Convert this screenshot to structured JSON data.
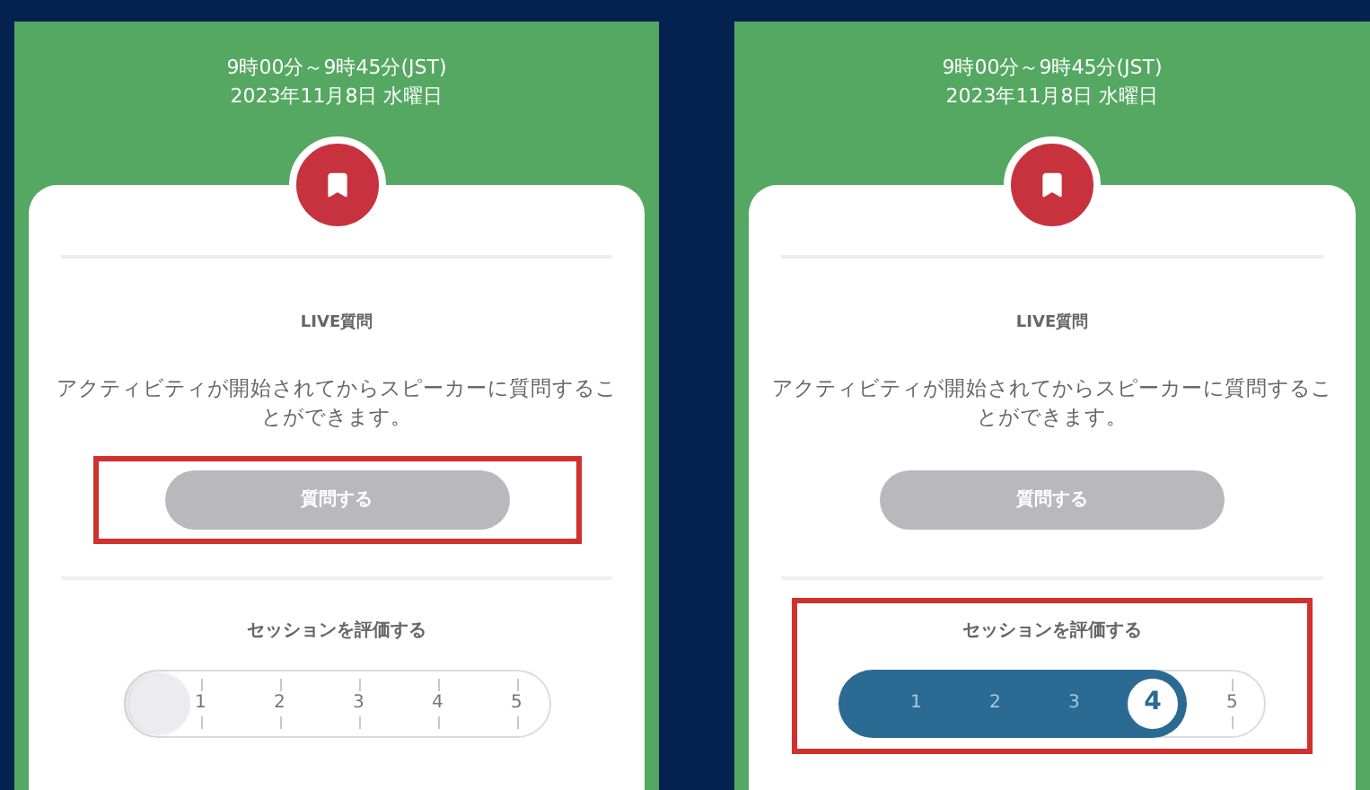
{
  "screens": [
    {
      "header": {
        "time": "9時00分～9時45分(JST)",
        "date": "2023年11月8日 水曜日"
      },
      "live_question": {
        "title": "LIVE質問",
        "description": "アクティビティが開始されてからスピーカーに質問することができます。",
        "button": {
          "label": "質問する",
          "disabled": true
        },
        "highlighted": true
      },
      "rating": {
        "title": "セッションを評価する",
        "scale": [
          "1",
          "2",
          "3",
          "4",
          "5"
        ],
        "level": 0,
        "highlighted": false
      }
    },
    {
      "header": {
        "time": "9時00分～9時45分(JST)",
        "date": "2023年11月8日 水曜日"
      },
      "live_question": {
        "title": "LIVE質問",
        "description": "アクティビティが開始されてからスピーカーに質問することができます。",
        "button": {
          "label": "質問する",
          "disabled": true
        },
        "highlighted": false
      },
      "rating": {
        "title": "セッションを評価する",
        "scale": [
          "1",
          "2",
          "3",
          "4",
          "5"
        ],
        "level": 0.8,
        "highlighted": true
      }
    }
  ]
}
